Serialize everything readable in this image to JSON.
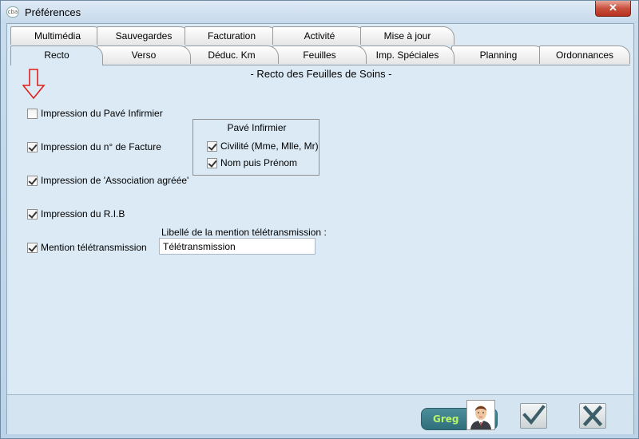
{
  "window": {
    "app_icon_text": "cba",
    "title": "Préférences",
    "close_symbol": "✕"
  },
  "tabs": {
    "row_back": [
      "Multimédia",
      "Sauvegardes",
      "Facturation",
      "Activité",
      "Mise à jour"
    ],
    "row_front": [
      "Recto",
      "Verso",
      "Déduc. Km",
      "Feuilles",
      "Imp. Spéciales",
      "Planning",
      "Ordonnances"
    ],
    "active": "Recto"
  },
  "page": {
    "heading": "- Recto des Feuilles de Soins -",
    "arrow_icon": "down-arrow-icon",
    "arrow_color": "#e0201a"
  },
  "options": [
    {
      "label": "Impression du Pavé Infirmier",
      "checked": false
    },
    {
      "label": "Impression du n° de Facture",
      "checked": true
    },
    {
      "label": "Impression de 'Association agréée'",
      "checked": true
    },
    {
      "label": "Impression du R.I.B",
      "checked": true
    },
    {
      "label": "Mention télétransmission",
      "checked": true
    }
  ],
  "pave_group": {
    "title": "Pavé Infirmier",
    "items": [
      {
        "label": "Civilité (Mme, Mlle, Mr)",
        "checked": true
      },
      {
        "label": "Nom puis Prénom",
        "checked": true
      }
    ]
  },
  "teletrans_field": {
    "label": "Libellé de la mention télétransmission :",
    "value": "Télétransmission"
  },
  "footer": {
    "user_name": "Greg",
    "ok_icon": "checkmark-icon",
    "cancel_icon": "close-x-icon"
  }
}
